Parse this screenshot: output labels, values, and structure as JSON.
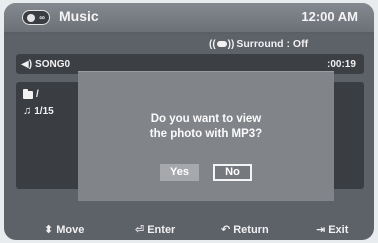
{
  "header": {
    "title": "Music",
    "time": "12:00 AM",
    "disc_icon": "disc-icon"
  },
  "status": {
    "surround_label": "Surround : Off",
    "surround_icon_left": "((",
    "surround_icon_right": "))"
  },
  "track": {
    "name": "SONG0",
    "time": ":00:19",
    "icon": "speaker-icon"
  },
  "info": {
    "folder": "/",
    "count": "1/15"
  },
  "dialog": {
    "line1": "Do you want to view",
    "line2": "the photo with MP3?",
    "yes_label": "Yes",
    "no_label": "No",
    "selected": "No"
  },
  "hints": {
    "move": "Move",
    "enter": "Enter",
    "return": "Return",
    "exit": "Exit"
  }
}
